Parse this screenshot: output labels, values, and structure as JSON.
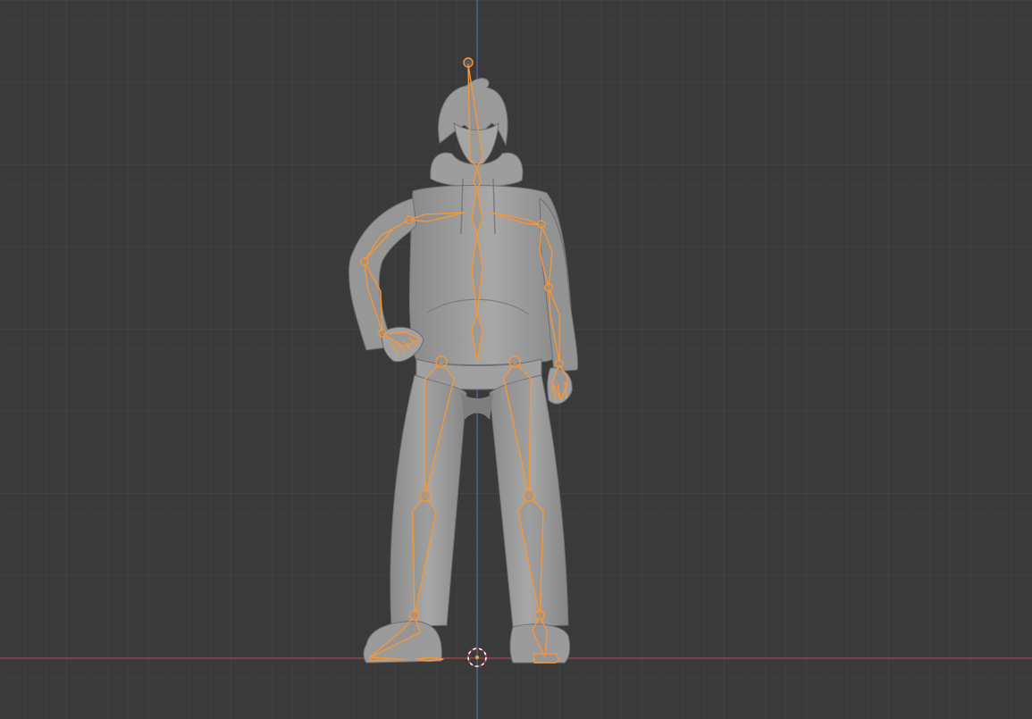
{
  "viewport": {
    "view": "front-orthographic",
    "mode": "pose",
    "grid_visible": true,
    "x_axis_color": "#a3404f",
    "z_axis_color": "#4a6ea8",
    "armature_color": "#f4973a",
    "mesh_color": "#9c9c9c",
    "background_color": "#3a3a3a"
  },
  "scene": {
    "mesh": {
      "name": "hoodie-character-mesh"
    },
    "armature": {
      "bones": [
        {
          "name": "head"
        },
        {
          "name": "neck"
        },
        {
          "name": "spine-upper"
        },
        {
          "name": "spine-mid"
        },
        {
          "name": "spine-lower"
        },
        {
          "name": "clavicle-left"
        },
        {
          "name": "upper-arm-left"
        },
        {
          "name": "forearm-left"
        },
        {
          "name": "hand-left"
        },
        {
          "name": "clavicle-right"
        },
        {
          "name": "upper-arm-right"
        },
        {
          "name": "forearm-right"
        },
        {
          "name": "hand-right"
        },
        {
          "name": "thigh-left"
        },
        {
          "name": "shin-left"
        },
        {
          "name": "foot-left"
        },
        {
          "name": "thigh-right"
        },
        {
          "name": "shin-right"
        },
        {
          "name": "foot-right"
        }
      ]
    },
    "cursor": {
      "icon": "3d-cursor-icon"
    }
  }
}
